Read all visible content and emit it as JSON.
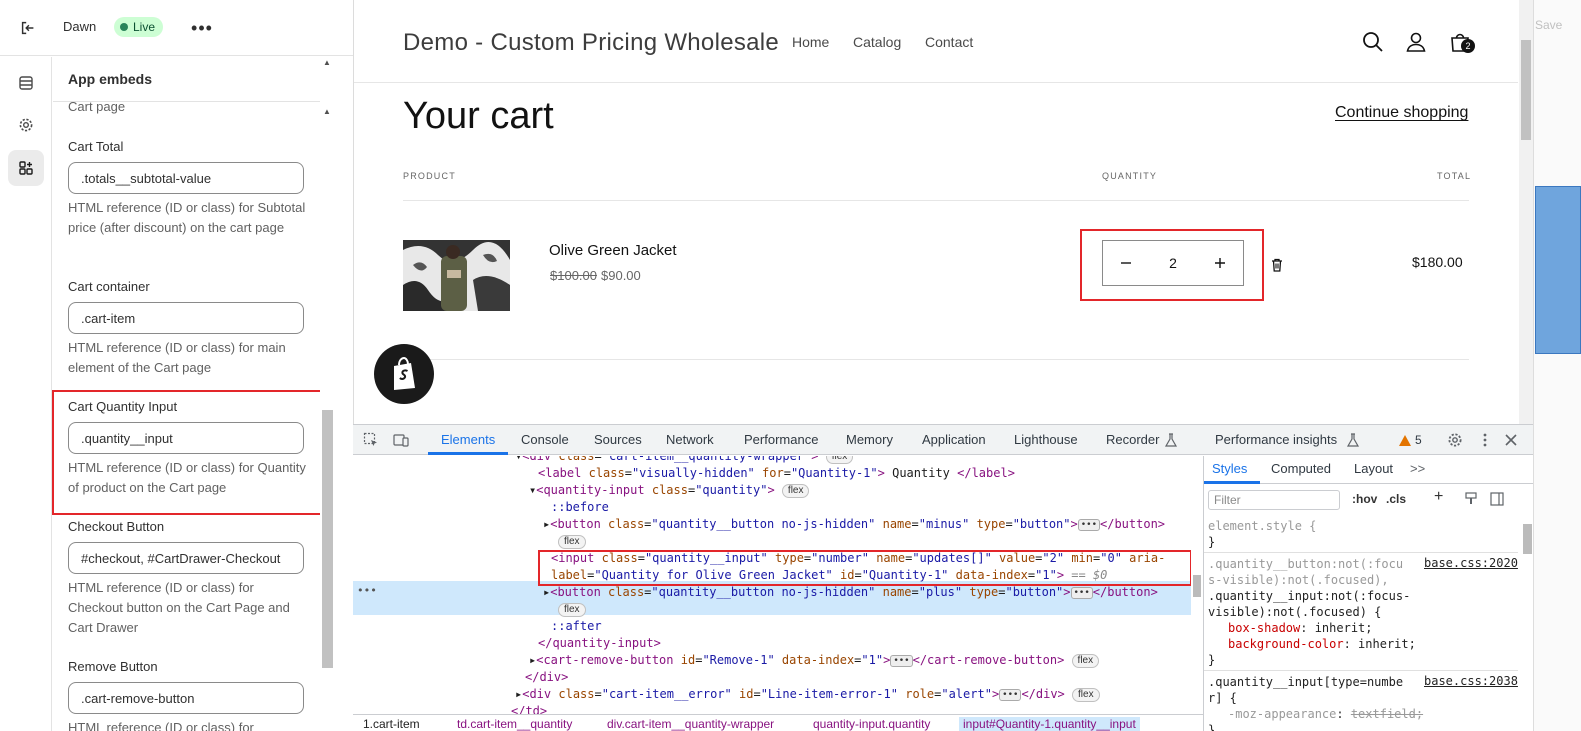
{
  "topbar": {
    "theme_name": "Dawn",
    "status": "Live",
    "more": "•••"
  },
  "panel": {
    "title": "App embeds",
    "cut_text": "Cart page",
    "fields": [
      {
        "label": "Cart Total",
        "value": ".totals__subtotal-value",
        "help": "HTML reference (ID or class) for Subtotal price (after discount) on the cart page"
      },
      {
        "label": "Cart container",
        "value": ".cart-item",
        "help": "HTML reference (ID or class) for main element of the Cart page"
      },
      {
        "label": "Cart Quantity Input",
        "value": ".quantity__input",
        "help": "HTML reference (ID or class) for Quantity of product on the Cart page"
      },
      {
        "label": "Checkout Button",
        "value": "#checkout, #CartDrawer-Checkout",
        "help": "HTML reference (ID or class) for Checkout button on the Cart Page and Cart Drawer"
      },
      {
        "label": "Remove Button",
        "value": ".cart-remove-button",
        "help": "HTML reference (ID or class) for"
      }
    ]
  },
  "store": {
    "logo": "Demo - Custom Pricing Wholesale",
    "nav": [
      "Home",
      "Catalog",
      "Contact"
    ],
    "cart_count": "2",
    "cart_title": "Your cart",
    "continue": "Continue shopping",
    "columns": {
      "product": "PRODUCT",
      "quantity": "QUANTITY",
      "total": "TOTAL"
    },
    "item": {
      "name": "Olive Green Jacket",
      "price_old": "$100.00",
      "price_new": "$90.00",
      "quantity": "2",
      "total": "$180.00"
    }
  },
  "edge": {
    "save": "Save"
  },
  "devtools": {
    "tabs": [
      "Elements",
      "Console",
      "Sources",
      "Network",
      "Performance",
      "Memory",
      "Application",
      "Lighthouse",
      "Recorder",
      "Performance insights"
    ],
    "warnings": "5",
    "styles_tabs": [
      "Styles",
      "Computed",
      "Layout"
    ],
    "filter_placeholder": "Filter",
    "hov": ":hov",
    "cls": ".cls",
    "breadcrumbs": [
      "1.cart-item",
      "td.cart-item__quantity",
      "div.cart-item__quantity-wrapper",
      "quantity-input.quantity",
      "input#Quantity-1.quantity__input"
    ],
    "rules": [
      {
        "selector": "element.style {",
        "close": "}"
      },
      {
        "selector_dim": ".quantity__button:not(:focu s-visible):not(.focused),",
        "selector": ".quantity__input:not(:focus- visible):not(.focused) {",
        "source": "base.css:2020",
        "decls": [
          [
            "box-shadow",
            "inherit;"
          ],
          [
            "background-color",
            "inherit;"
          ]
        ],
        "close": "}"
      },
      {
        "selector": ".quantity__input[type=numbe r] {",
        "source": "base.css:2038",
        "decls": [
          [
            "-moz-appearance",
            "textfield;"
          ]
        ],
        "close": "}"
      }
    ]
  }
}
